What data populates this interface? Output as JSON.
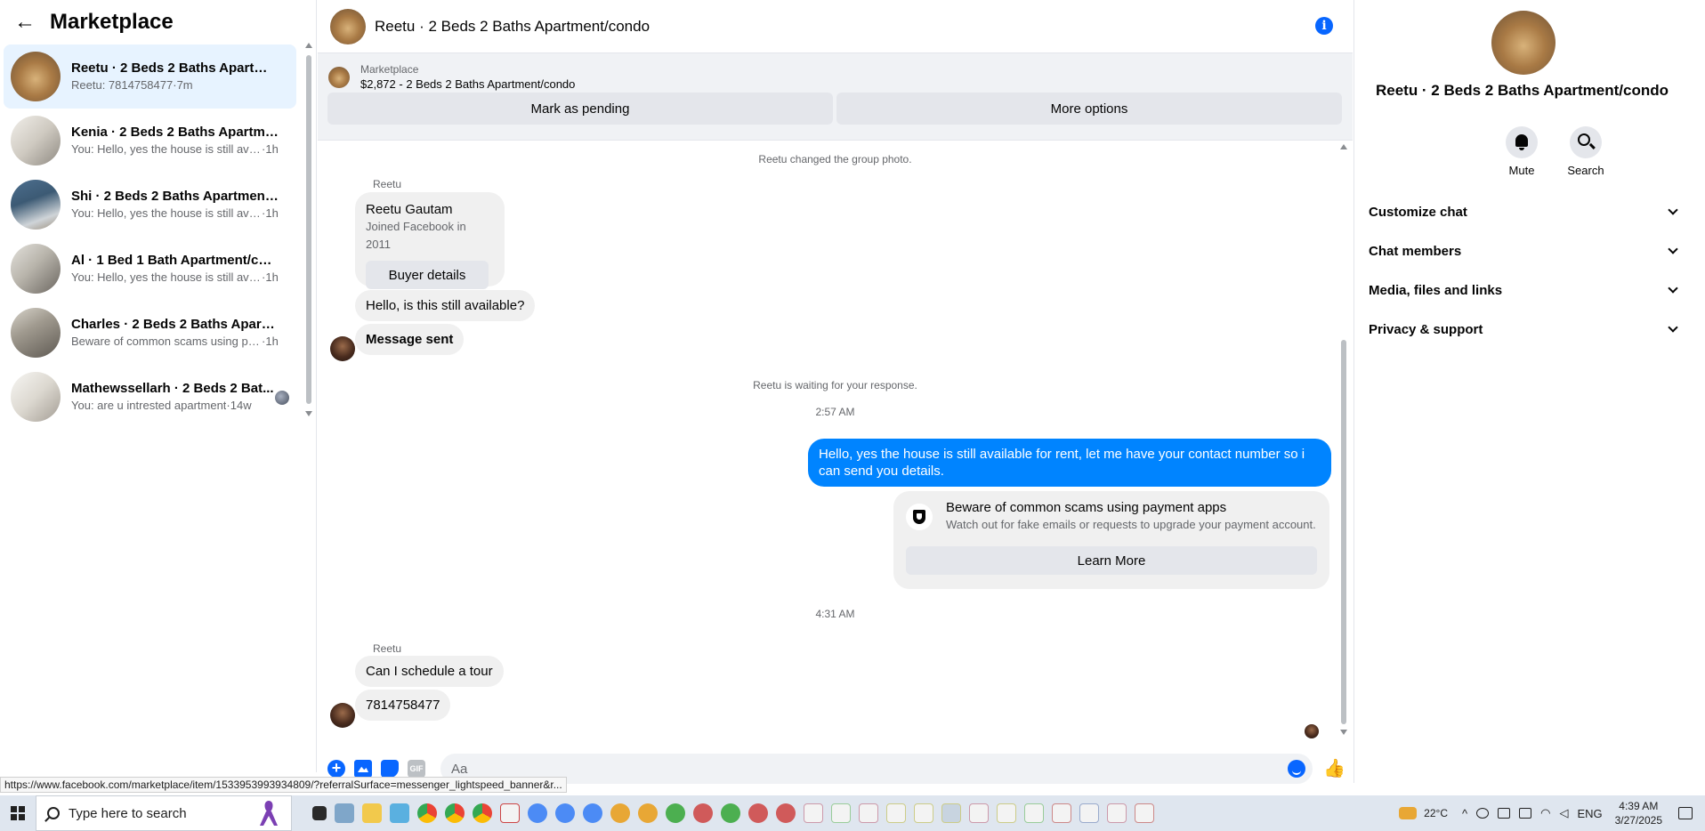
{
  "sidebar": {
    "title": "Marketplace",
    "conversations": [
      {
        "name": "Reetu · 2 Beds 2 Baths Apartme...",
        "preview": "Reetu: 7814758477",
        "time": "7m",
        "active": true
      },
      {
        "name": "Kenia · 2 Beds 2 Baths Apartmen...",
        "preview": "You: Hello, yes the house is still avai...",
        "time": "1h"
      },
      {
        "name": "Shi · 2 Beds 2 Baths Apartment/...",
        "preview": "You: Hello, yes the house is still avai...",
        "time": "1h"
      },
      {
        "name": "Al · 1 Bed 1 Bath Apartment/con...",
        "preview": "You: Hello, yes the house is still avai...",
        "time": "1h"
      },
      {
        "name": "Charles · 2 Beds 2 Baths Apartm...",
        "preview": "Beware of common scams using pa...",
        "time": "1h"
      },
      {
        "name": "Mathewssellarh · 2 Beds 2 Bat...",
        "preview": "You: are u intrested apartment",
        "time": "14w"
      }
    ]
  },
  "chat": {
    "title": "Reetu · 2 Beds 2 Baths Apartment/condo",
    "listing": {
      "label": "Marketplace",
      "price_title": "$2,872 - 2 Beds 2 Baths Apartment/condo",
      "btn_pending": "Mark as pending",
      "btn_more": "More options"
    },
    "notes": {
      "group_photo": "Reetu changed the group photo.",
      "waiting": "Reetu is waiting for your response.",
      "time1": "2:57 AM",
      "time2": "4:31 AM"
    },
    "sender_label": "Reetu",
    "contact_card": {
      "name": "Reetu Gautam",
      "joined": "Joined Facebook in 2011",
      "button": "Buyer details"
    },
    "messages": {
      "m1": "Hello, is this still available?",
      "m2": "Message sent",
      "out1": "Hello, yes the house is still available for rent, let me have your contact number so i can send you details.",
      "m3": "Can I schedule a tour",
      "m4": "7814758477"
    },
    "scam_card": {
      "title": "Beware of common scams using payment apps",
      "subtitle": "Watch out for fake emails or requests to upgrade your payment account.",
      "button": "Learn More"
    },
    "composer": {
      "placeholder": "Aa",
      "gif_label": "GIF"
    }
  },
  "right_panel": {
    "title": "Reetu · 2 Beds 2 Baths Apartment/condo",
    "mute": "Mute",
    "search": "Search",
    "sections": [
      "Customize chat",
      "Chat members",
      "Media, files and links",
      "Privacy & support"
    ]
  },
  "status_url": "https://www.facebook.com/marketplace/item/1533953993934809/?referralSurface=messenger_lightspeed_banner&r...",
  "taskbar": {
    "search_placeholder": "Type here to search",
    "weather": "22°C",
    "lang": "ENG",
    "time": "4:39 AM",
    "date": "3/27/2025"
  },
  "colors": {
    "accent": "#0866ff",
    "outgoing_bubble": "#0084ff",
    "active_conversation": "#e7f3ff"
  }
}
